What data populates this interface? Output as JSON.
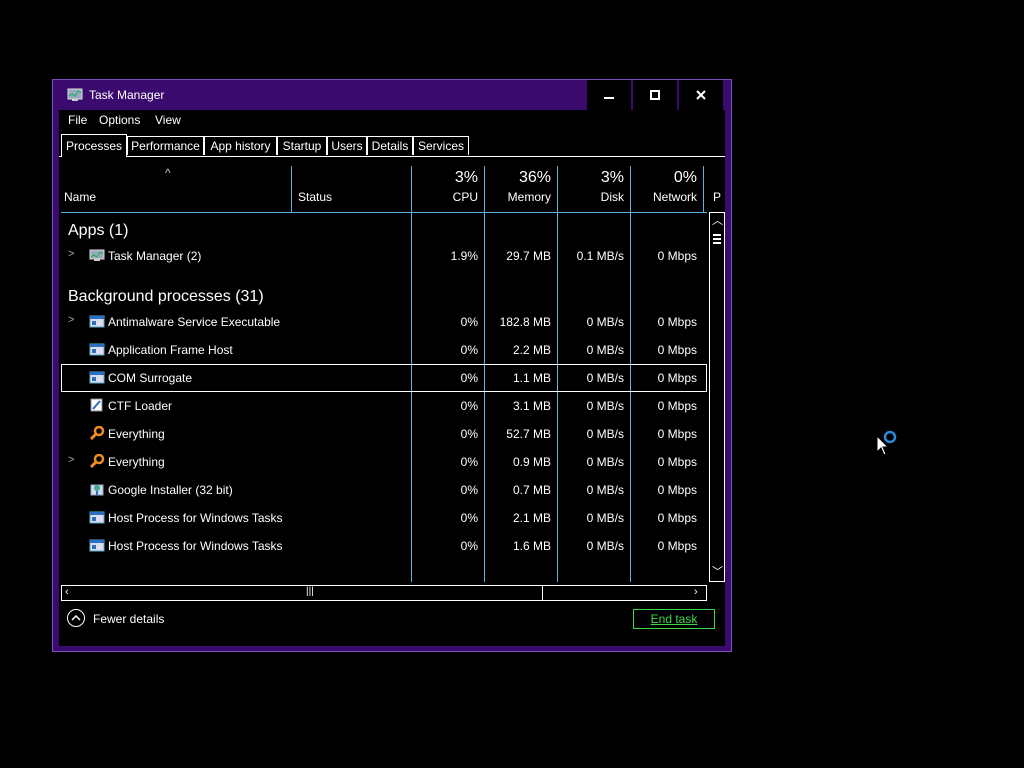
{
  "window": {
    "title": "Task Manager",
    "controls": {
      "minimize": "‒",
      "maximize": "□",
      "close": "✕"
    }
  },
  "menu": [
    "File",
    "Options",
    "View"
  ],
  "tabs": [
    "Processes",
    "Performance",
    "App history",
    "Startup",
    "Users",
    "Details",
    "Services"
  ],
  "columns": {
    "name": "Name",
    "status": "Status",
    "cpu": {
      "pct": "3%",
      "label": "CPU"
    },
    "memory": {
      "pct": "36%",
      "label": "Memory"
    },
    "disk": {
      "pct": "3%",
      "label": "Disk"
    },
    "network": {
      "pct": "0%",
      "label": "Network"
    },
    "power": "P"
  },
  "groups": {
    "apps": "Apps (1)",
    "background": "Background processes (31)"
  },
  "rows": [
    {
      "name": "Task Manager (2)",
      "cpu": "1.9%",
      "mem": "29.7 MB",
      "disk": "0.1 MB/s",
      "net": "0 Mbps",
      "icon": "task-manager-icon",
      "expand": true
    },
    {
      "name": "Antimalware Service Executable",
      "cpu": "0%",
      "mem": "182.8 MB",
      "disk": "0 MB/s",
      "net": "0 Mbps",
      "icon": "window-icon",
      "expand": true
    },
    {
      "name": "Application Frame Host",
      "cpu": "0%",
      "mem": "2.2 MB",
      "disk": "0 MB/s",
      "net": "0 Mbps",
      "icon": "window-icon",
      "expand": false
    },
    {
      "name": "COM Surrogate",
      "cpu": "0%",
      "mem": "1.1 MB",
      "disk": "0 MB/s",
      "net": "0 Mbps",
      "icon": "window-icon",
      "expand": false,
      "selected": true
    },
    {
      "name": "CTF Loader",
      "cpu": "0%",
      "mem": "3.1 MB",
      "disk": "0 MB/s",
      "net": "0 Mbps",
      "icon": "pen-icon",
      "expand": false
    },
    {
      "name": "Everything",
      "cpu": "0%",
      "mem": "52.7 MB",
      "disk": "0 MB/s",
      "net": "0 Mbps",
      "icon": "search-icon",
      "expand": false
    },
    {
      "name": "Everything",
      "cpu": "0%",
      "mem": "0.9 MB",
      "disk": "0 MB/s",
      "net": "0 Mbps",
      "icon": "search-icon",
      "expand": true
    },
    {
      "name": "Google Installer (32 bit)",
      "cpu": "0%",
      "mem": "0.7 MB",
      "disk": "0 MB/s",
      "net": "0 Mbps",
      "icon": "installer-icon",
      "expand": false
    },
    {
      "name": "Host Process for Windows Tasks",
      "cpu": "0%",
      "mem": "2.1 MB",
      "disk": "0 MB/s",
      "net": "0 Mbps",
      "icon": "window-icon",
      "expand": false
    },
    {
      "name": "Host Process for Windows Tasks",
      "cpu": "0%",
      "mem": "1.6 MB",
      "disk": "0 MB/s",
      "net": "0 Mbps",
      "icon": "window-icon",
      "expand": false
    }
  ],
  "footer": {
    "fewer_details": "Fewer details",
    "end_task": "End task"
  },
  "colors": {
    "accent": "#3a0a6e",
    "column_line": "#5fb0e0",
    "end_task": "#3bd94b"
  }
}
